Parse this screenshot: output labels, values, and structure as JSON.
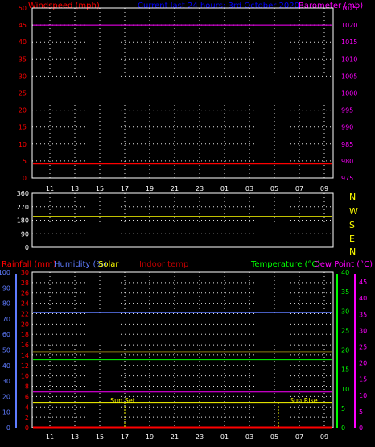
{
  "colors": {
    "wind": "#ff0000",
    "baro": "#ff00ff",
    "humidity": "#5f7cff",
    "solar": "#ffff00",
    "indoor": "#c00000",
    "temperature": "#00ff00",
    "dewpoint": "#ff00ff",
    "rain": "#ff0000",
    "title": "#0000ff",
    "axis_label": "#ffffff",
    "grid": "#ffffff",
    "frame": "#ffffff",
    "direction": "#ffff00",
    "sun": "#ffff00"
  },
  "header": {
    "wind_label": "Windspeed (mph)",
    "title": "Current last 24 hours: 3rd October 2020",
    "baro_label": "Barometer (mb)"
  },
  "legend": {
    "rain": "Rainfall (mm)",
    "humidity": "Humidity (%)",
    "solar": "Solar",
    "indoor": "Indoor temp",
    "temperature": "Temperature (°C)",
    "dewpoint": "Dew Point (°C)"
  },
  "sun": {
    "set": "Sun Set",
    "rise": "Sun Rise"
  },
  "chart_data": [
    {
      "type": "line",
      "title": "",
      "x_tick_labels": [
        "11",
        "13",
        "15",
        "17",
        "19",
        "21",
        "23",
        "01",
        "03",
        "05",
        "07",
        "09"
      ],
      "left_axis": {
        "label": "Windspeed (mph)",
        "ticks": [
          "0",
          "5",
          "10",
          "15",
          "20",
          "25",
          "30",
          "35",
          "40",
          "45",
          "50"
        ],
        "ylim": [
          0,
          50
        ]
      },
      "right_axis": {
        "label": "Barometer (mb)",
        "ticks": [
          "975",
          "980",
          "985",
          "990",
          "995",
          "1000",
          "1005",
          "1010",
          "1015",
          "1020",
          "1025"
        ],
        "ylim": [
          975,
          1025
        ]
      },
      "series": [
        {
          "name": "Windspeed (mph)",
          "axis": "left",
          "values": [
            4.2,
            4.2,
            4.2,
            4.2,
            4.2,
            4.2,
            4.2,
            4.2,
            4.2,
            4.2,
            4.2,
            4.2
          ]
        },
        {
          "name": "Barometer (mb)",
          "axis": "left",
          "values": [
            45,
            45,
            45,
            45,
            45,
            45,
            45,
            45,
            45,
            45,
            45,
            45
          ]
        }
      ],
      "grid": true
    },
    {
      "type": "scatter",
      "x_tick_labels": [
        "11",
        "13",
        "15",
        "17",
        "19",
        "21",
        "23",
        "01",
        "03",
        "05",
        "07",
        "09"
      ],
      "left_axis": {
        "ticks": [
          "0",
          "90",
          "180",
          "270",
          "360"
        ],
        "ylim": [
          0,
          360
        ]
      },
      "compass_labels": [
        "N",
        "W",
        "S",
        "E",
        "N"
      ],
      "series": [
        {
          "name": "Wind direction",
          "values": [
            205,
            205,
            205,
            205,
            205,
            205,
            205,
            205,
            205,
            205,
            205,
            205
          ]
        }
      ],
      "grid": true
    },
    {
      "type": "line",
      "x_tick_labels": [
        "11",
        "13",
        "15",
        "17",
        "19",
        "21",
        "23",
        "01",
        "03",
        "05",
        "07",
        "09"
      ],
      "axes": {
        "humidity": {
          "label": "Humidity (%)",
          "ticks": [
            "0",
            "10",
            "20",
            "30",
            "40",
            "50",
            "60",
            "70",
            "80",
            "90",
            "100"
          ],
          "ylim": [
            0,
            100
          ]
        },
        "rain": {
          "label": "Rainfall (mm)",
          "ticks": [
            "0",
            "2",
            "4",
            "6",
            "8",
            "10",
            "12",
            "14",
            "16",
            "18",
            "20",
            "22",
            "24",
            "26",
            "28",
            "30"
          ],
          "ylim": [
            0,
            30
          ]
        },
        "temperature": {
          "label": "Temperature (°C)",
          "ticks": [
            "0",
            "5",
            "10",
            "15",
            "20",
            "25",
            "30",
            "35",
            "40"
          ],
          "ylim": [
            0,
            40
          ]
        },
        "dewpoint": {
          "label": "Dew Point (°C)",
          "ticks": [
            "0",
            "5",
            "10",
            "15",
            "20",
            "25",
            "30",
            "35",
            "40",
            "45"
          ],
          "ylim": [
            0,
            48
          ]
        }
      },
      "series": [
        {
          "name": "Humidity (%)",
          "axis": "humidity",
          "values": [
            74,
            74,
            74,
            74,
            74,
            74,
            74,
            74,
            74,
            74,
            74,
            74
          ]
        },
        {
          "name": "Indoor temp",
          "axis": "temperature",
          "values": [
            19.5,
            19.5,
            19.5,
            19.5,
            19.5,
            19.5,
            19.5,
            19.5,
            19.5,
            19.5,
            19.5,
            19.5
          ]
        },
        {
          "name": "Temperature (°C)",
          "axis": "temperature",
          "values": [
            17.5,
            17.5,
            17.5,
            17.5,
            17.5,
            17.5,
            17.5,
            17.5,
            17.5,
            17.5,
            17.5,
            17.5
          ]
        },
        {
          "name": "Dew Point (°C)",
          "axis": "dewpoint",
          "values": [
            11,
            11,
            11,
            11,
            11,
            11,
            11,
            11,
            11,
            11,
            11,
            11
          ]
        },
        {
          "name": "Solar",
          "axis": "temperature",
          "values": [
            6.5,
            6.5,
            6.5,
            6.5,
            6.5,
            6.5,
            6.5,
            6.5,
            6.5,
            6.5,
            6.5,
            6.5
          ]
        },
        {
          "name": "Rainfall (mm)",
          "axis": "rain",
          "values": [
            0,
            0,
            0,
            0,
            0,
            0,
            0,
            0,
            0,
            0,
            0,
            0
          ]
        }
      ],
      "sun_marker_hours": [
        "19",
        "07"
      ],
      "grid": true
    }
  ]
}
